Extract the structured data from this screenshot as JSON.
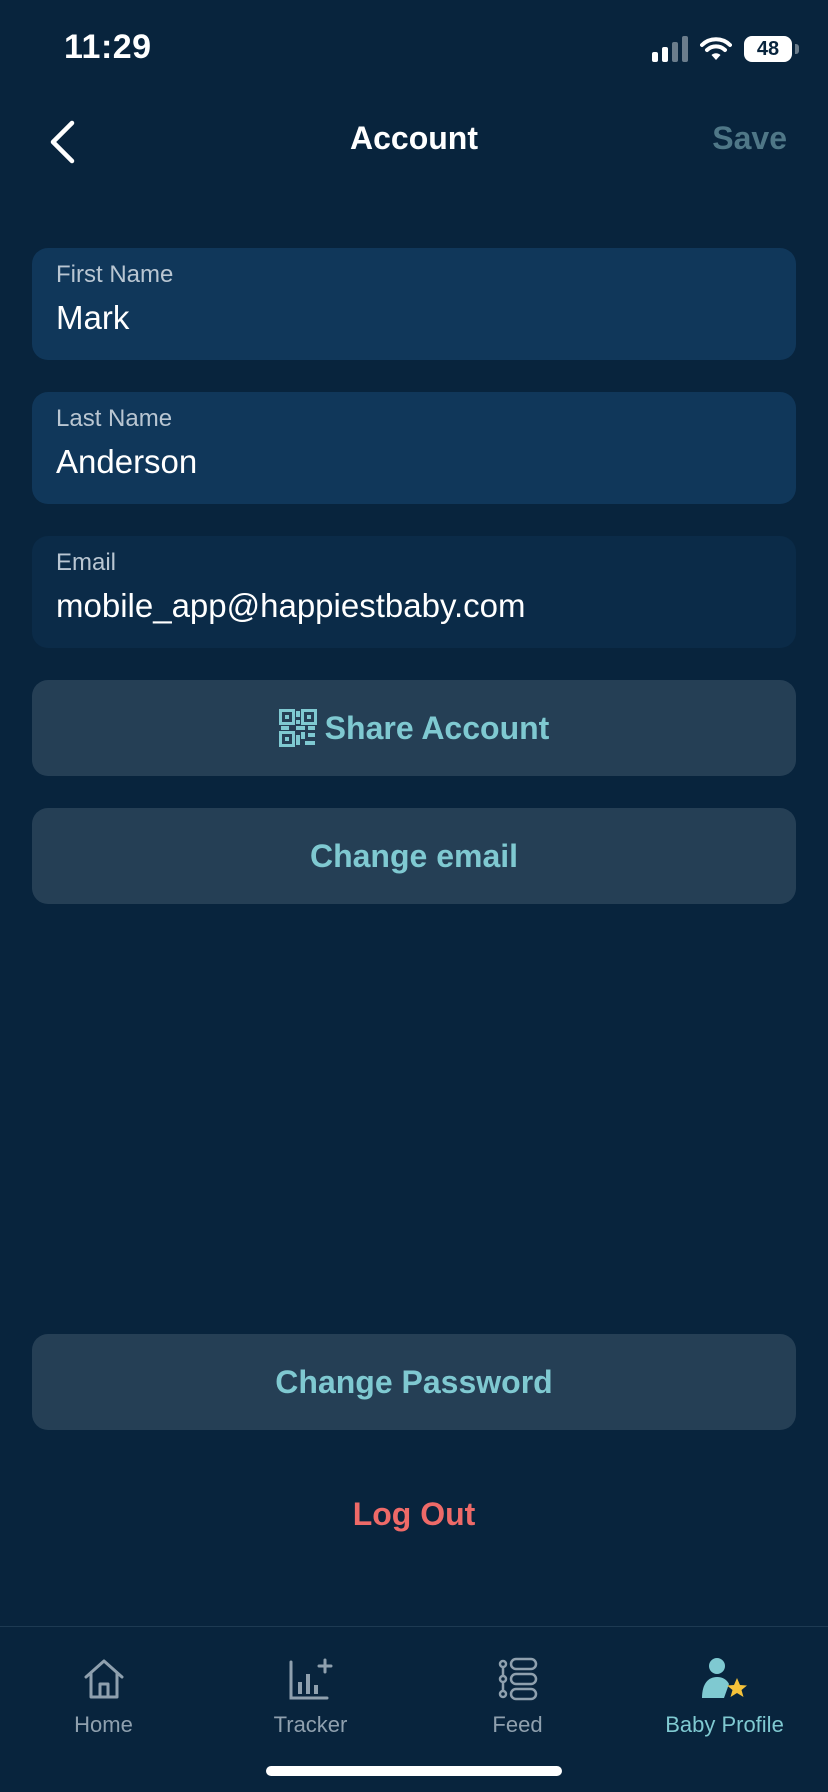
{
  "status_bar": {
    "time": "11:29",
    "battery": "48"
  },
  "nav": {
    "title": "Account",
    "save_label": "Save",
    "back_icon": "chevron-left-icon"
  },
  "fields": {
    "first_name": {
      "label": "First Name",
      "value": "Mark"
    },
    "last_name": {
      "label": "Last Name",
      "value": "Anderson"
    },
    "email": {
      "label": "Email",
      "value": "mobile_app@happiestbaby.com"
    }
  },
  "buttons": {
    "share_account": "Share Account",
    "change_email": "Change email",
    "change_password": "Change Password",
    "log_out": "Log Out"
  },
  "tabs": [
    {
      "label": "Home",
      "icon": "home-icon",
      "active": false
    },
    {
      "label": "Tracker",
      "icon": "tracker-chart-icon",
      "active": false
    },
    {
      "label": "Feed",
      "icon": "feed-list-icon",
      "active": false
    },
    {
      "label": "Baby Profile",
      "icon": "baby-profile-icon",
      "active": true
    }
  ],
  "colors": {
    "background": "#08243d",
    "field_background": "#10375a",
    "button_background": "#253f55",
    "accent": "#7fc9d1",
    "danger": "#ee6a68",
    "muted_save": "#4f7787"
  }
}
